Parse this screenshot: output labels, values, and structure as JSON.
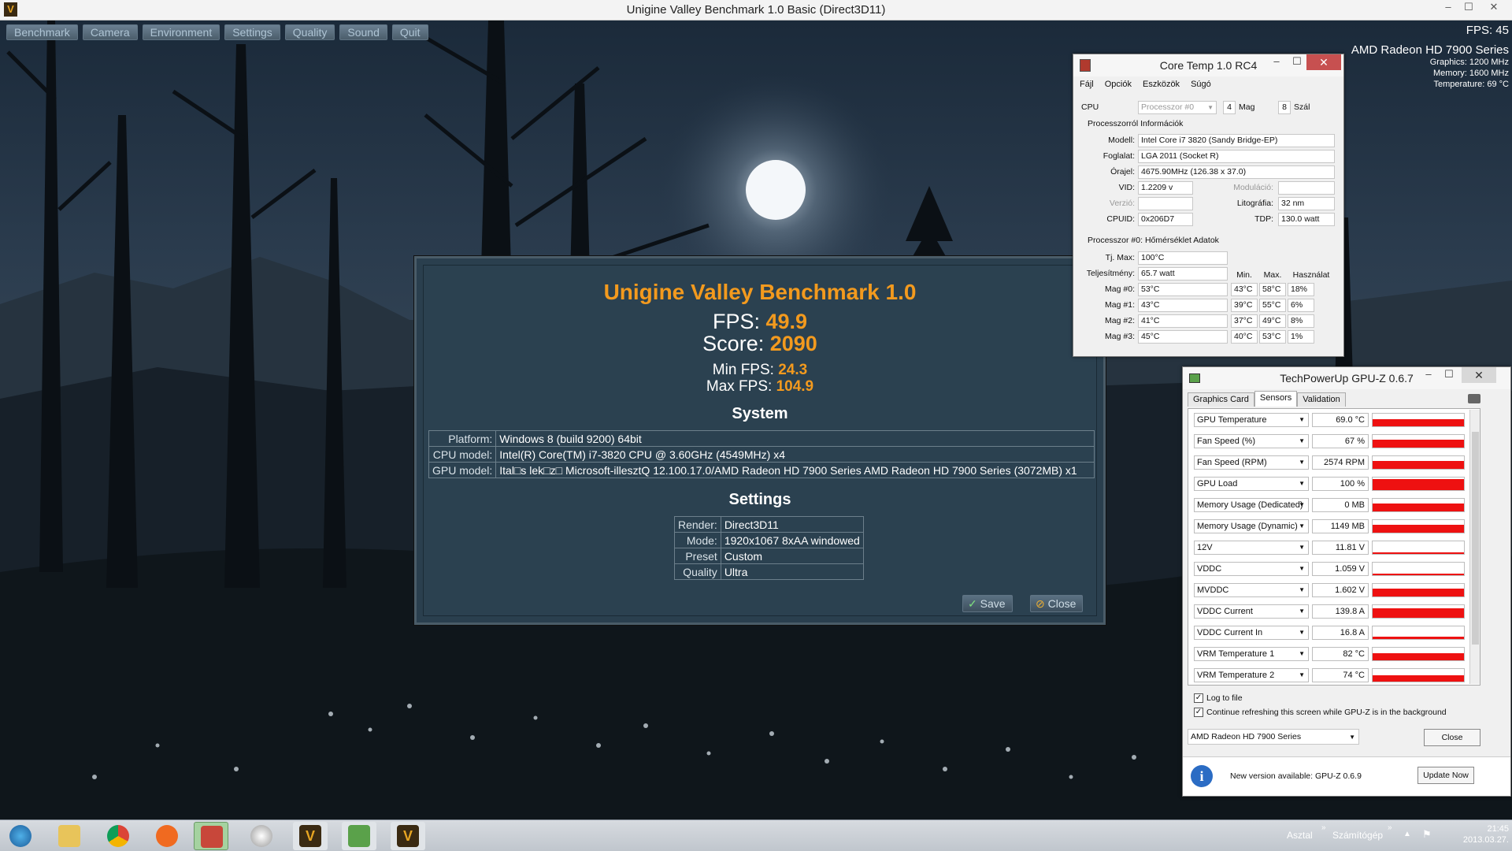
{
  "window": {
    "title": "Unigine Valley Benchmark 1.0 Basic (Direct3D11)",
    "minimize": "–",
    "maximize": "☐",
    "close": "✕",
    "app_icon": "V"
  },
  "menu": [
    "Benchmark",
    "Camera",
    "Environment",
    "Settings",
    "Quality",
    "Sound",
    "Quit"
  ],
  "overlay": {
    "fps": "FPS: 45",
    "gpu": "AMD Radeon HD 7900 Series",
    "graphics": "Graphics: 1200 MHz",
    "memory": "Memory: 1600 MHz",
    "temperature": "Temperature: 69 °C"
  },
  "results": {
    "title": "Unigine Valley Benchmark 1.0",
    "fps_label": "FPS:",
    "fps_value": "49.9",
    "score_label": "Score:",
    "score_value": "2090",
    "min_fps_label": "Min FPS:",
    "min_fps_value": "24.3",
    "max_fps_label": "Max FPS:",
    "max_fps_value": "104.9",
    "system_heading": "System",
    "system": [
      {
        "k": "Platform:",
        "v": "Windows 8 (build 9200) 64bit"
      },
      {
        "k": "CPU model:",
        "v": "Intel(R) Core(TM) i7-3820 CPU @ 3.60GHz (4549MHz) x4"
      },
      {
        "k": "GPU model:",
        "v": "Ital□s lek□z□  Microsoft-illesztQ 12.100.17.0/AMD Radeon HD 7900 Series AMD Radeon HD 7900 Series (3072MB) x1"
      }
    ],
    "settings_heading": "Settings",
    "settings": [
      {
        "k": "Render:",
        "v": "Direct3D11"
      },
      {
        "k": "Mode:",
        "v": "1920x1067 8xAA windowed"
      },
      {
        "k": "Preset",
        "v": "Custom"
      },
      {
        "k": "Quality",
        "v": "Ultra"
      }
    ],
    "save": "Save",
    "close": "Close"
  },
  "coretemp": {
    "title": "Core Temp 1.0 RC4",
    "menu": [
      "Fájl",
      "Opciók",
      "Eszközök",
      "Súgó"
    ],
    "cpu_label": "CPU",
    "processor_select": "Processzor #0",
    "cores": "4",
    "cores_label": "Mag",
    "threads": "8",
    "threads_label": "Szál",
    "info_heading": "Processzorról Információk",
    "model_label": "Modell:",
    "model": "Intel Core i7 3820 (Sandy Bridge-EP)",
    "socket_label": "Foglalat:",
    "socket": "LGA 2011 (Socket R)",
    "clock_label": "Órajel:",
    "clock": "4675.90MHz (126.38 x 37.0)",
    "vid_label": "VID:",
    "vid": "1.2209 v",
    "modulation_label": "Moduláció:",
    "modulation": "",
    "version_label": "Verzió:",
    "version": "",
    "litho_label": "Litográfia:",
    "litho": "32 nm",
    "cpuid_label": "CPUID:",
    "cpuid": "0x206D7",
    "tdp_label": "TDP:",
    "tdp": "130.0 watt",
    "temp_heading": "Processzor #0: Hőmérséklet Adatok",
    "tjmax_label": "Tj. Max:",
    "tjmax": "100°C",
    "power_label": "Teljesítmény:",
    "power": "65.7 watt",
    "col_min": "Min.",
    "col_max": "Max.",
    "col_load": "Használat",
    "cores_data": [
      {
        "label": "Mag #0:",
        "temp": "53°C",
        "min": "43°C",
        "max": "58°C",
        "load": "18%"
      },
      {
        "label": "Mag #1:",
        "temp": "43°C",
        "min": "39°C",
        "max": "55°C",
        "load": "6%"
      },
      {
        "label": "Mag #2:",
        "temp": "41°C",
        "min": "37°C",
        "max": "49°C",
        "load": "8%"
      },
      {
        "label": "Mag #3:",
        "temp": "45°C",
        "min": "40°C",
        "max": "53°C",
        "load": "1%"
      }
    ]
  },
  "gpuz": {
    "title": "TechPowerUp GPU-Z 0.6.7",
    "tabs": [
      "Graphics Card",
      "Sensors",
      "Validation"
    ],
    "sensors": [
      {
        "name": "GPU Temperature",
        "value": "69.0 °C",
        "level": 0.55
      },
      {
        "name": "Fan Speed (%)",
        "value": "67 %",
        "level": 0.6
      },
      {
        "name": "Fan Speed (RPM)",
        "value": "2574 RPM",
        "level": 0.6
      },
      {
        "name": "GPU Load",
        "value": "100 %",
        "level": 0.85
      },
      {
        "name": "Memory Usage (Dedicated)",
        "value": "0 MB",
        "level": 0.6
      },
      {
        "name": "Memory Usage (Dynamic)",
        "value": "1149 MB",
        "level": 0.6
      },
      {
        "name": "12V",
        "value": "11.81 V",
        "level": 0.15
      },
      {
        "name": "VDDC",
        "value": "1.059 V",
        "level": 0.12
      },
      {
        "name": "MVDDC",
        "value": "1.602 V",
        "level": 0.6
      },
      {
        "name": "VDDC Current",
        "value": "139.8 A",
        "level": 0.75
      },
      {
        "name": "VDDC Current In",
        "value": "16.8 A",
        "level": 0.2
      },
      {
        "name": "VRM Temperature 1",
        "value": "82 °C",
        "level": 0.55
      },
      {
        "name": "VRM Temperature 2",
        "value": "74 °C",
        "level": 0.5
      }
    ],
    "log_to_file": "Log to file",
    "continue_refresh": "Continue refreshing this screen while GPU-Z is in the background",
    "device_select": "AMD Radeon HD 7900 Series",
    "close": "Close",
    "update_msg": "New version available: GPU-Z 0.6.9",
    "update_btn": "Update Now"
  },
  "taskbar": {
    "desktop_label": "Asztal",
    "computer_label": "Számítógép",
    "time": "21:45",
    "date": "2013.03.27."
  }
}
